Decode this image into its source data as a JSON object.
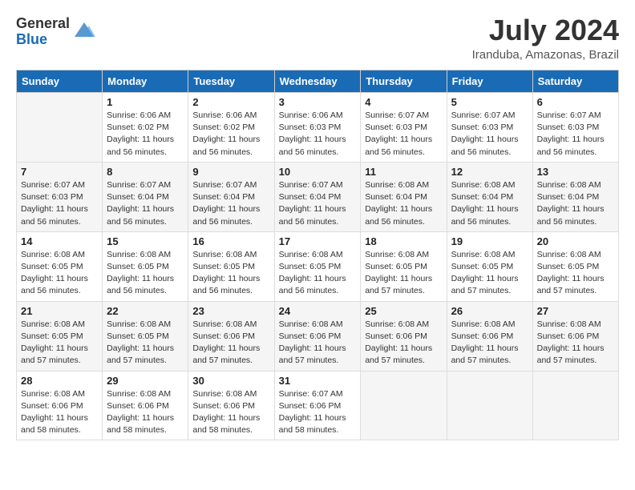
{
  "header": {
    "logo_general": "General",
    "logo_blue": "Blue",
    "month_year": "July 2024",
    "location": "Iranduba, Amazonas, Brazil"
  },
  "days_of_week": [
    "Sunday",
    "Monday",
    "Tuesday",
    "Wednesday",
    "Thursday",
    "Friday",
    "Saturday"
  ],
  "weeks": [
    [
      {
        "num": "",
        "info": ""
      },
      {
        "num": "1",
        "info": "Sunrise: 6:06 AM\nSunset: 6:02 PM\nDaylight: 11 hours\nand 56 minutes."
      },
      {
        "num": "2",
        "info": "Sunrise: 6:06 AM\nSunset: 6:02 PM\nDaylight: 11 hours\nand 56 minutes."
      },
      {
        "num": "3",
        "info": "Sunrise: 6:06 AM\nSunset: 6:03 PM\nDaylight: 11 hours\nand 56 minutes."
      },
      {
        "num": "4",
        "info": "Sunrise: 6:07 AM\nSunset: 6:03 PM\nDaylight: 11 hours\nand 56 minutes."
      },
      {
        "num": "5",
        "info": "Sunrise: 6:07 AM\nSunset: 6:03 PM\nDaylight: 11 hours\nand 56 minutes."
      },
      {
        "num": "6",
        "info": "Sunrise: 6:07 AM\nSunset: 6:03 PM\nDaylight: 11 hours\nand 56 minutes."
      }
    ],
    [
      {
        "num": "7",
        "info": "Sunrise: 6:07 AM\nSunset: 6:03 PM\nDaylight: 11 hours\nand 56 minutes."
      },
      {
        "num": "8",
        "info": "Sunrise: 6:07 AM\nSunset: 6:04 PM\nDaylight: 11 hours\nand 56 minutes."
      },
      {
        "num": "9",
        "info": "Sunrise: 6:07 AM\nSunset: 6:04 PM\nDaylight: 11 hours\nand 56 minutes."
      },
      {
        "num": "10",
        "info": "Sunrise: 6:07 AM\nSunset: 6:04 PM\nDaylight: 11 hours\nand 56 minutes."
      },
      {
        "num": "11",
        "info": "Sunrise: 6:08 AM\nSunset: 6:04 PM\nDaylight: 11 hours\nand 56 minutes."
      },
      {
        "num": "12",
        "info": "Sunrise: 6:08 AM\nSunset: 6:04 PM\nDaylight: 11 hours\nand 56 minutes."
      },
      {
        "num": "13",
        "info": "Sunrise: 6:08 AM\nSunset: 6:04 PM\nDaylight: 11 hours\nand 56 minutes."
      }
    ],
    [
      {
        "num": "14",
        "info": "Sunrise: 6:08 AM\nSunset: 6:05 PM\nDaylight: 11 hours\nand 56 minutes."
      },
      {
        "num": "15",
        "info": "Sunrise: 6:08 AM\nSunset: 6:05 PM\nDaylight: 11 hours\nand 56 minutes."
      },
      {
        "num": "16",
        "info": "Sunrise: 6:08 AM\nSunset: 6:05 PM\nDaylight: 11 hours\nand 56 minutes."
      },
      {
        "num": "17",
        "info": "Sunrise: 6:08 AM\nSunset: 6:05 PM\nDaylight: 11 hours\nand 56 minutes."
      },
      {
        "num": "18",
        "info": "Sunrise: 6:08 AM\nSunset: 6:05 PM\nDaylight: 11 hours\nand 57 minutes."
      },
      {
        "num": "19",
        "info": "Sunrise: 6:08 AM\nSunset: 6:05 PM\nDaylight: 11 hours\nand 57 minutes."
      },
      {
        "num": "20",
        "info": "Sunrise: 6:08 AM\nSunset: 6:05 PM\nDaylight: 11 hours\nand 57 minutes."
      }
    ],
    [
      {
        "num": "21",
        "info": "Sunrise: 6:08 AM\nSunset: 6:05 PM\nDaylight: 11 hours\nand 57 minutes."
      },
      {
        "num": "22",
        "info": "Sunrise: 6:08 AM\nSunset: 6:05 PM\nDaylight: 11 hours\nand 57 minutes."
      },
      {
        "num": "23",
        "info": "Sunrise: 6:08 AM\nSunset: 6:06 PM\nDaylight: 11 hours\nand 57 minutes."
      },
      {
        "num": "24",
        "info": "Sunrise: 6:08 AM\nSunset: 6:06 PM\nDaylight: 11 hours\nand 57 minutes."
      },
      {
        "num": "25",
        "info": "Sunrise: 6:08 AM\nSunset: 6:06 PM\nDaylight: 11 hours\nand 57 minutes."
      },
      {
        "num": "26",
        "info": "Sunrise: 6:08 AM\nSunset: 6:06 PM\nDaylight: 11 hours\nand 57 minutes."
      },
      {
        "num": "27",
        "info": "Sunrise: 6:08 AM\nSunset: 6:06 PM\nDaylight: 11 hours\nand 57 minutes."
      }
    ],
    [
      {
        "num": "28",
        "info": "Sunrise: 6:08 AM\nSunset: 6:06 PM\nDaylight: 11 hours\nand 58 minutes."
      },
      {
        "num": "29",
        "info": "Sunrise: 6:08 AM\nSunset: 6:06 PM\nDaylight: 11 hours\nand 58 minutes."
      },
      {
        "num": "30",
        "info": "Sunrise: 6:08 AM\nSunset: 6:06 PM\nDaylight: 11 hours\nand 58 minutes."
      },
      {
        "num": "31",
        "info": "Sunrise: 6:07 AM\nSunset: 6:06 PM\nDaylight: 11 hours\nand 58 minutes."
      },
      {
        "num": "",
        "info": ""
      },
      {
        "num": "",
        "info": ""
      },
      {
        "num": "",
        "info": ""
      }
    ]
  ]
}
